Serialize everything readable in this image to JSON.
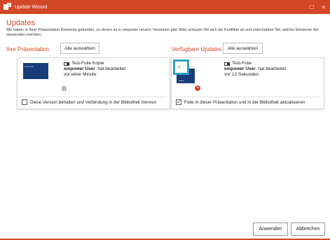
{
  "window": {
    "title": "Update Wizard",
    "minimize_glyph": "—",
    "maximize_glyph": "☐",
    "close_glyph": "✕",
    "accent_color": "#d24726",
    "selection_color": "#2ba1c9"
  },
  "header": {
    "title": "Updates",
    "description": "Wir haben in Ihrer Präsentation Elemente gefunden, zu denen es in empower neuere Versionen gibt. Bitte schauen Sie sich die Konflikte an und entscheiden Sie, welche Elemente Sie verwenden möchten."
  },
  "left": {
    "label": "Ihre Präsentation",
    "select_all": "Alle auswählen",
    "card": {
      "thumb_text": "Test-Folie",
      "slide_name": "Test-Folie Kopie",
      "user": "empower User",
      "action": "hat bearbeitet",
      "time": "vor einer Minute",
      "option_label": "Diese Version behalten und Verbindung in der Bibliothek trennen",
      "option_checked": false,
      "icon": "link-icon"
    }
  },
  "right": {
    "label": "Verfügbare Updates",
    "select_all": "Alle auswählen",
    "card": {
      "slide_name": "Test-Folie",
      "user": "empower User",
      "action": "hat bearbeitet",
      "time": "vor 13 Sekunden",
      "option_label": "Folie in dieser Präsentation und in der Bibliothek aktualisieren",
      "option_checked": true,
      "check_glyph": "✓",
      "magnifier_glyph": "⌕",
      "minus_glyph": "−"
    }
  },
  "footer": {
    "apply": "Anwenden",
    "cancel": "Abbrechen"
  }
}
